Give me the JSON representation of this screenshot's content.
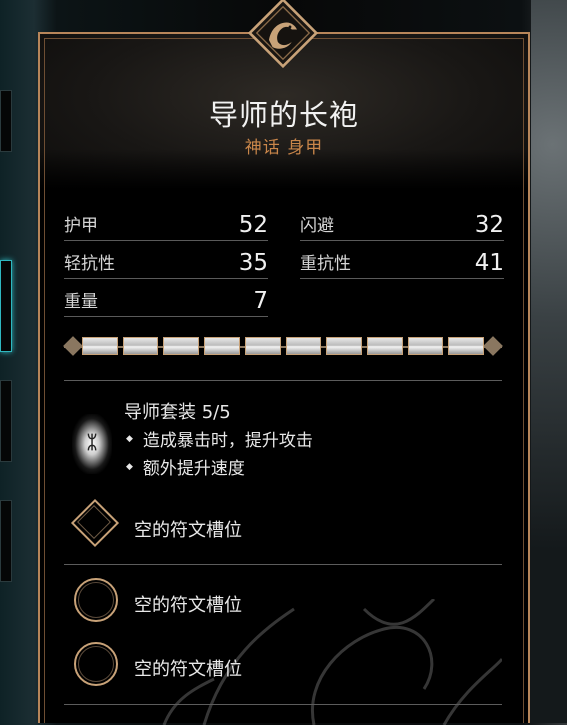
{
  "item": {
    "name": "导师的长袍",
    "subtitle": "神话 身甲"
  },
  "stats": [
    {
      "label": "护甲",
      "value": "52"
    },
    {
      "label": "闪避",
      "value": "32"
    },
    {
      "label": "轻抗性",
      "value": "35"
    },
    {
      "label": "重抗性",
      "value": "41"
    },
    {
      "label": "重量",
      "value": "7"
    }
  ],
  "upgrade_bar": {
    "filled_segments": 10,
    "total_segments": 10
  },
  "set_bonus": {
    "icon_glyph": "ᛯ",
    "title": "导师套装 5/5",
    "bullets": [
      "造成暴击时，提升攻击",
      "额外提升速度"
    ]
  },
  "rune_slots": [
    {
      "label": "空的符文槽位",
      "shape": "diamond"
    },
    {
      "label": "空的符文槽位",
      "shape": "circle"
    },
    {
      "label": "空的符文槽位",
      "shape": "circle"
    }
  ],
  "colors": {
    "accent": "#c8a278",
    "subtitle": "#c9864a",
    "selection_glow": "#2fb8c0"
  },
  "icons": {
    "emblem": "raven-emblem-icon",
    "set": "set-bonus-rune-icon"
  }
}
